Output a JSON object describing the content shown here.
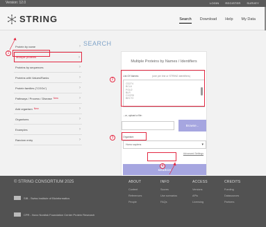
{
  "topbar": {
    "version": "Version: 12.0",
    "links": [
      "LOGIN",
      "REGISTER",
      "SURVEY"
    ]
  },
  "header": {
    "logo_text": "STRING",
    "nav": [
      "Search",
      "Download",
      "Help",
      "My Data"
    ]
  },
  "sidebar": {
    "items": [
      {
        "label": "Protein by name"
      },
      {
        "label": "Multiple proteins"
      },
      {
        "label": "Proteins by sequences"
      },
      {
        "label": "Proteins with Values/Ranks"
      },
      {
        "label": "Protein families (\"COGs\")"
      },
      {
        "label": "Pathways / Process / Disease",
        "badge": "New"
      },
      {
        "label": "Add organism",
        "badge": "New"
      },
      {
        "label": "Organisms"
      },
      {
        "label": "Examples"
      },
      {
        "label": "Random entry"
      }
    ]
  },
  "main": {
    "section_title": "SEARCH",
    "card_title": "Multiple Proteins by Names / Identifiers",
    "list_label": "List Of Names:",
    "list_hint": "(one per line or STRING identifiers)",
    "list_lines": [
      "CD274",
      "BCL6",
      "POU2",
      "BLR",
      "CXCR5",
      "BECT2"
    ],
    "upload_label": "...or, upload a file:",
    "browse_label": "Browse...",
    "organism_label": "Organism:",
    "organism_value": "Homo sapiens",
    "advanced_label": "Advanced Settings",
    "search_label": "SEARCH"
  },
  "annotations": [
    "1",
    "2",
    "3",
    "4"
  ],
  "footer": {
    "copyright": "© STRING CONSORTIUM 2025",
    "institutions": [
      "SIB - Swiss Institute of Bioinformatics",
      "CPR - Novo Nordisk Foundation Center Protein Research"
    ],
    "columns": [
      {
        "heading": "ABOUT",
        "items": [
          "Content",
          "References",
          "People"
        ]
      },
      {
        "heading": "INFO",
        "items": [
          "Scores",
          "Use scenarios",
          "FAQs"
        ]
      },
      {
        "heading": "ACCESS",
        "items": [
          "Versions",
          "APIs",
          "Licensing"
        ]
      },
      {
        "heading": "CREDITS",
        "items": [
          "Funding",
          "Datasources",
          "Partners"
        ]
      }
    ]
  },
  "colors": {
    "accent": "#e2253f",
    "button": "#a6a6e0",
    "title": "#7fa3c8"
  }
}
